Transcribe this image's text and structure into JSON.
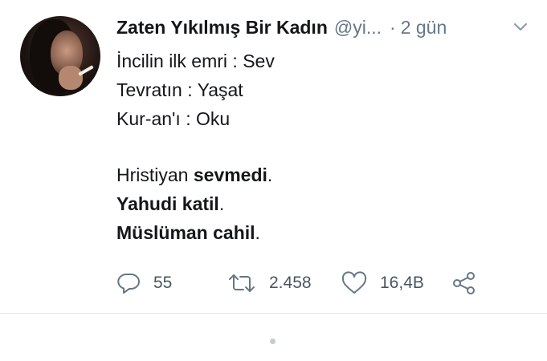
{
  "tweet": {
    "author_name": "Zaten Yıkılmış Bir Kadın",
    "handle": "@yi...",
    "separator": "·",
    "time": "2 gün",
    "lines": [
      "İncilin ilk emri : Sev",
      "Tevratın : Yaşat",
      "Kur-an'ı : Oku"
    ],
    "line4": {
      "prefix": "Hristiyan ",
      "bold": "sevmedi",
      "suffix": "."
    },
    "line5": {
      "bold": "Yahudi katil",
      "suffix": "."
    },
    "line6": {
      "bold": "Müslüman cahil",
      "suffix": "."
    },
    "actions": {
      "reply_count": "55",
      "retweet_count": "2.458",
      "like_count": "16,4B"
    }
  },
  "colors": {
    "text": "#14171a",
    "secondary": "#657786",
    "icon": "#657786",
    "divider": "#e1e8ed"
  },
  "icons": {
    "menu": "chevron-down-icon",
    "reply": "reply-icon",
    "retweet": "retweet-icon",
    "like": "heart-icon",
    "share": "share-icon"
  }
}
